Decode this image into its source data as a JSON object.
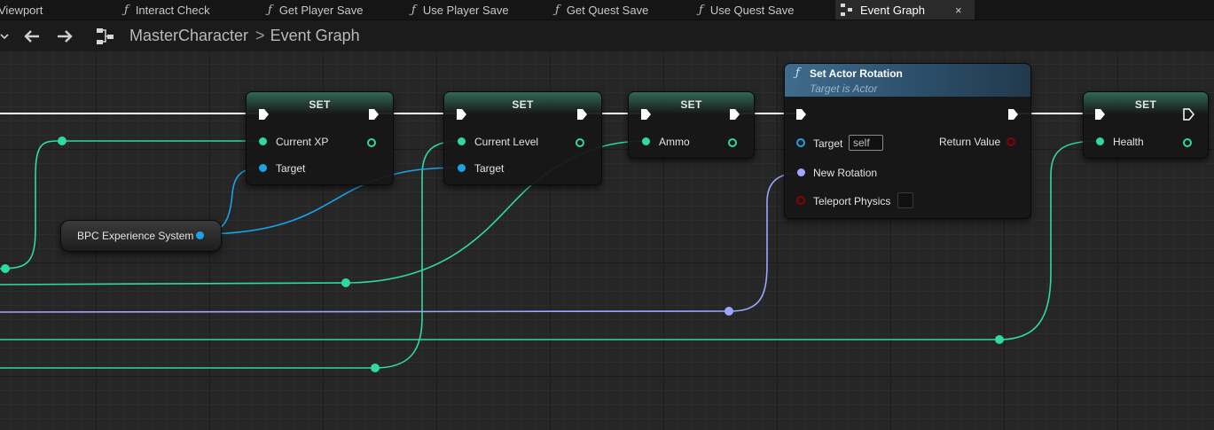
{
  "tabs": [
    {
      "label": "Viewport",
      "type": "viewport"
    },
    {
      "label": "Interact Check",
      "type": "function"
    },
    {
      "label": "Get Player Save",
      "type": "function"
    },
    {
      "label": "Use Player Save",
      "type": "function"
    },
    {
      "label": "Get Quest Save",
      "type": "function"
    },
    {
      "label": "Use Quest Save",
      "type": "function"
    },
    {
      "label": "Event Graph",
      "type": "graph",
      "active": true,
      "close": "×"
    }
  ],
  "toolbar": {
    "breadcrumb": [
      "MasterCharacter",
      "Event Graph"
    ],
    "separator": ">",
    "icons": [
      "chevron-down-icon",
      "back-arrow-icon",
      "forward-arrow-icon",
      "graph-icon"
    ]
  },
  "nodes": {
    "set_xp": {
      "title": "SET",
      "pin_value": "Current XP",
      "pin_target": "Target"
    },
    "set_level": {
      "title": "SET",
      "pin_value": "Current Level",
      "pin_target": "Target"
    },
    "set_ammo": {
      "title": "SET",
      "pin_value": "Ammo"
    },
    "set_rotation": {
      "title": "Set Actor Rotation",
      "subtitle": "Target is Actor",
      "pin_target": "Target",
      "target_default": "self",
      "pin_new_rotation": "New Rotation",
      "pin_teleport": "Teleport Physics",
      "teleport_checked": false,
      "pin_return": "Return Value"
    },
    "set_health": {
      "title": "SET",
      "pin_value": "Health"
    },
    "bpc_var": {
      "label": "BPC Experience System"
    }
  },
  "colors": {
    "float_pin": "#2fd9a1",
    "object_pin": "#1aa3e8",
    "rotator_pin": "#9fa6ff",
    "bool_pin": "#8b0000",
    "exec_wire": "#ffffff"
  }
}
